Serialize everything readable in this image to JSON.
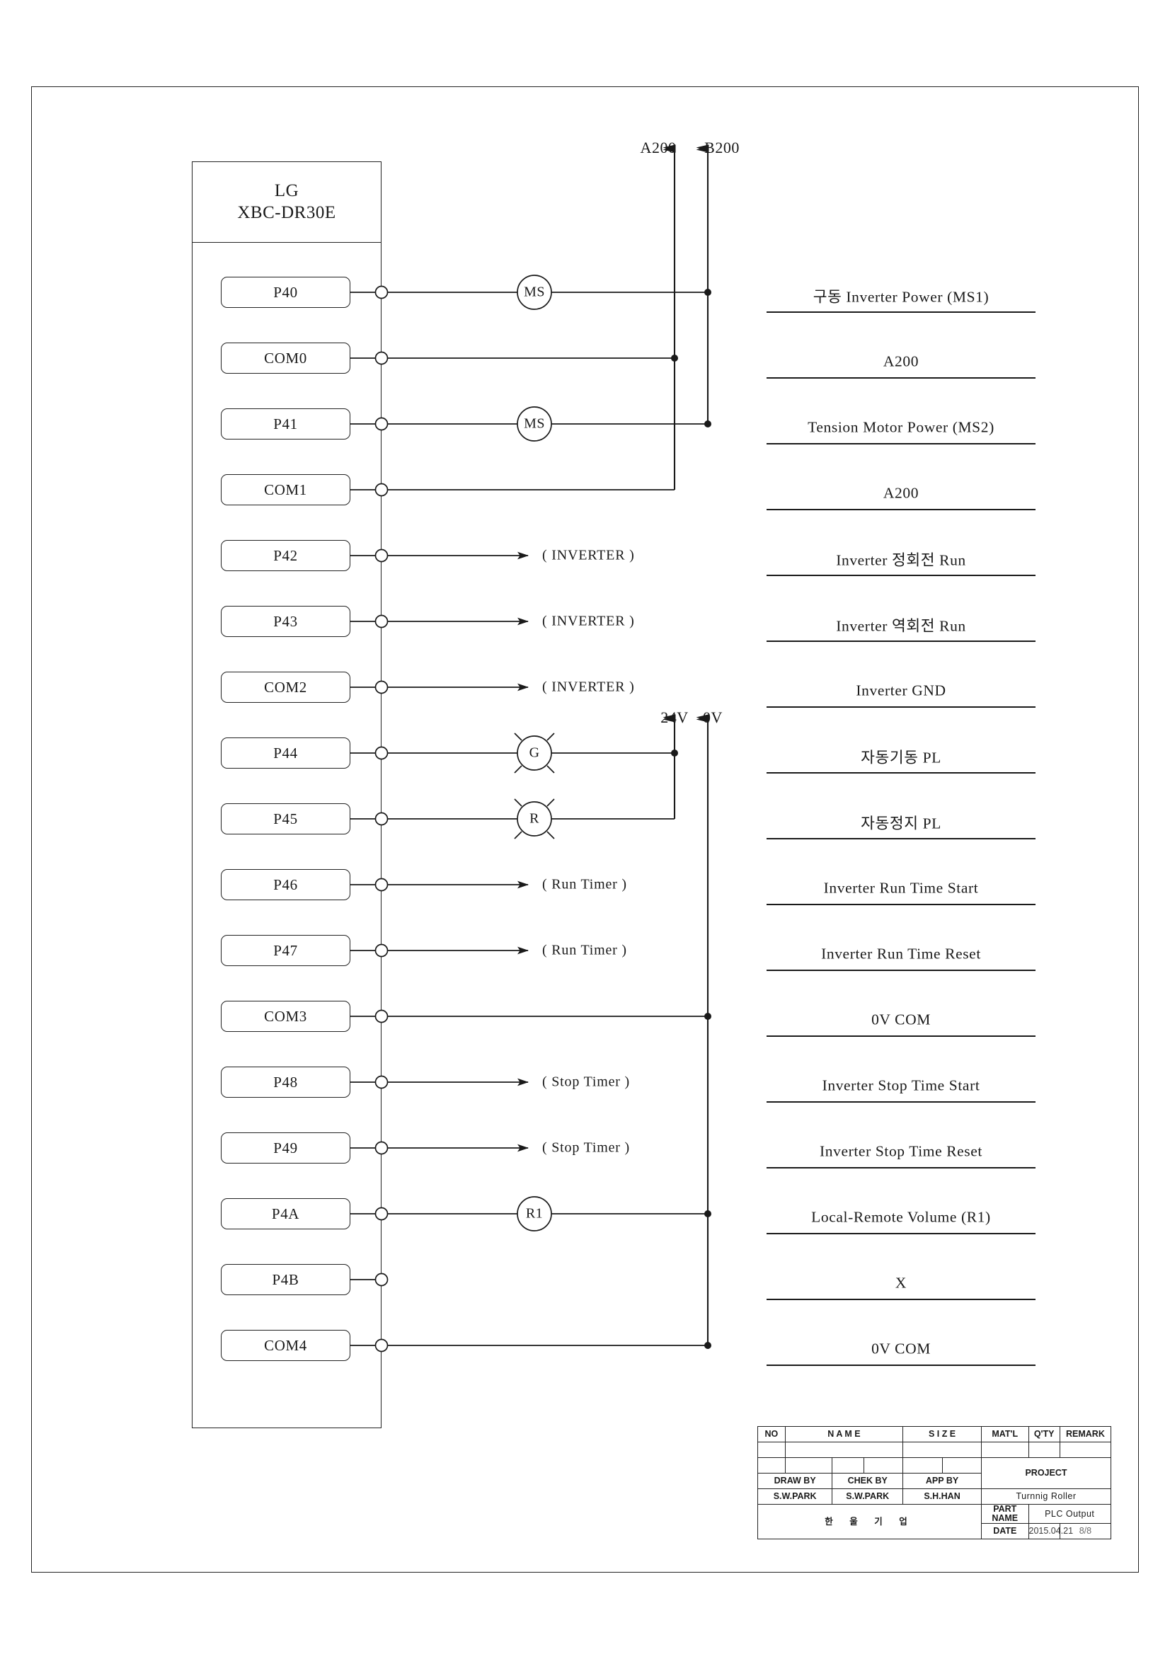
{
  "drawing": {
    "module": {
      "brand": "LG",
      "model": "XBC-DR30E"
    },
    "bus_labels": {
      "a200": "A200",
      "b200": "B200",
      "v24": "24V",
      "v0": "0V"
    },
    "rows": [
      {
        "terminal": "P40",
        "device": "MS",
        "device_type": "coil",
        "desc": "구동 Inverter Power (MS1)"
      },
      {
        "terminal": "COM0",
        "device": "",
        "device_type": "none",
        "desc": "A200"
      },
      {
        "terminal": "P41",
        "device": "MS",
        "device_type": "coil",
        "desc": "Tension Motor Power (MS2)"
      },
      {
        "terminal": "COM1",
        "device": "",
        "device_type": "none",
        "desc": "A200"
      },
      {
        "terminal": "P42",
        "device": "( INVERTER )",
        "device_type": "arrow",
        "desc": "Inverter 정회전 Run"
      },
      {
        "terminal": "P43",
        "device": "( INVERTER )",
        "device_type": "arrow",
        "desc": "Inverter 역회전 Run"
      },
      {
        "terminal": "COM2",
        "device": "( INVERTER )",
        "device_type": "arrow",
        "desc": "Inverter GND"
      },
      {
        "terminal": "P44",
        "device": "G",
        "device_type": "lamp",
        "desc": "자동기동 PL"
      },
      {
        "terminal": "P45",
        "device": "R",
        "device_type": "lamp",
        "desc": "자동정지 PL"
      },
      {
        "terminal": "P46",
        "device": "( Run Timer )",
        "device_type": "arrow",
        "desc": "Inverter Run Time Start"
      },
      {
        "terminal": "P47",
        "device": "( Run Timer )",
        "device_type": "arrow",
        "desc": "Inverter Run Time Reset"
      },
      {
        "terminal": "COM3",
        "device": "",
        "device_type": "none",
        "desc": "0V COM"
      },
      {
        "terminal": "P48",
        "device": "( Stop Timer )",
        "device_type": "arrow",
        "desc": "Inverter Stop Time Start"
      },
      {
        "terminal": "P49",
        "device": "( Stop Timer )",
        "device_type": "arrow",
        "desc": "Inverter Stop Time Reset"
      },
      {
        "terminal": "P4A",
        "device": "R1",
        "device_type": "coil",
        "desc": "Local-Remote Volume (R1)"
      },
      {
        "terminal": "P4B",
        "device": "",
        "device_type": "none",
        "desc": "X"
      },
      {
        "terminal": "COM4",
        "device": "",
        "device_type": "none",
        "desc": "0V COM"
      }
    ]
  },
  "title_block": {
    "headers": {
      "no": "NO",
      "name": "N A M E",
      "size": "S I Z E",
      "matl": "MAT'L",
      "qty": "Q'TY",
      "remark": "REMARK"
    },
    "roles": {
      "draw_by": "DRAW BY",
      "check_by": "CHEK BY",
      "app_by": "APP BY"
    },
    "people": {
      "draw_by": "S.W.PARK",
      "check_by": "S.W.PARK",
      "app_by": "S.H.HAN"
    },
    "company": "한 울 기 업",
    "project_label": "PROJECT",
    "project_value": "Turnnig Roller",
    "part_label_1": "PART",
    "part_label_2": "NAME",
    "part_value": "PLC Output",
    "date_label": "DATE",
    "date_value": "2015.04.21",
    "page_value": "8/8"
  }
}
